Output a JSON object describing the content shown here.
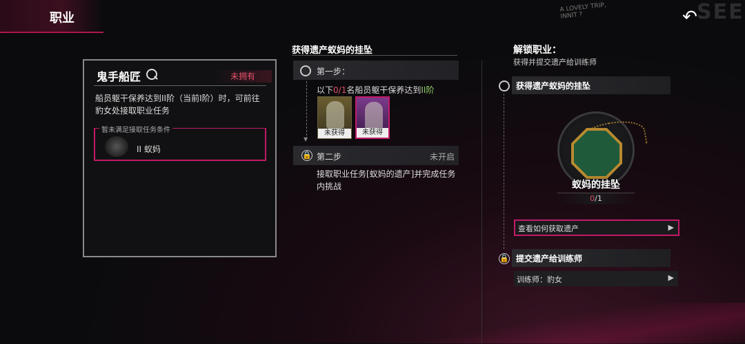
{
  "header": {
    "title": "职业",
    "back_icon": "back-arrow-icon",
    "graffiti": "A LOVELY TRIP, INNIT ?",
    "graffiti_big": "SEE"
  },
  "card": {
    "name": "鬼手船匠",
    "status": "未拥有",
    "description": "船员躯干保养达到II阶（当前I阶）时，可前往豹女处接取职业任务",
    "requirement_title": "暂未满足接取任务条件",
    "requirement_text": "II 蚁妈"
  },
  "middle": {
    "title": "获得遗产蚁妈的挂坠",
    "step1": {
      "label": "第一步：",
      "text_prefix": "以下",
      "count_current": "0",
      "count_sep": "/1",
      "text_mid": "名船员躯干保养达到",
      "level": "II阶",
      "characters": [
        {
          "label": "未获得"
        },
        {
          "label": "未获得"
        }
      ]
    },
    "step2": {
      "label": "第二步",
      "status": "未开启",
      "text": "接取职业任务[蚁妈的遗产]并完成任务内挑战"
    }
  },
  "right": {
    "title": "解锁职业：",
    "subtitle": "获得并提交遗产给训练师",
    "step1_label": "获得遗产蚁妈的挂坠",
    "item_name": "蚁妈的挂坠",
    "item_count_current": "0",
    "item_count_total": "/1",
    "how_to_label": "查看如何获取遗产",
    "step2_label": "提交遗产给训练师",
    "trainer_label": "训练师：豹女"
  },
  "colors": {
    "accent": "#c21a68",
    "warning": "#e0506a",
    "success": "#8fcf6a"
  }
}
